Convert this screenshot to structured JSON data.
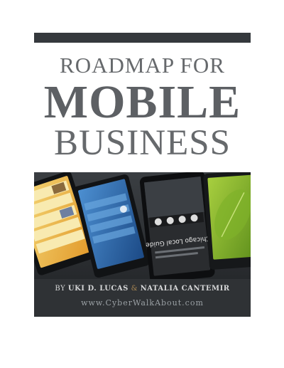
{
  "cover": {
    "title_line1": "ROADMAP  FOR",
    "title_line2": "MOBILE",
    "title_line3": "BUSINESS",
    "byline_prefix": "BY",
    "author1": "UKI D. LUCAS",
    "amp": "&",
    "author2": "NATALIA CANTEMIR",
    "website": "www.CyberWalkAbout.com",
    "phone_label": "Chicago Local Guide"
  },
  "colors": {
    "title_gray": "#66696c",
    "band_dark": "#2b2e31",
    "top_bar": "#35393d",
    "accent_amp": "#a98752"
  }
}
